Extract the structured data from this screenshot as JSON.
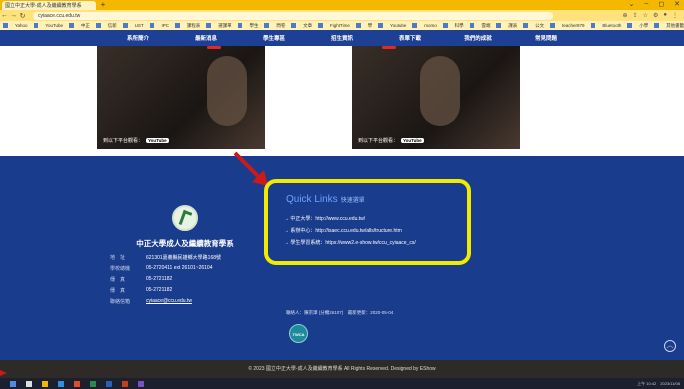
{
  "browser": {
    "tab_title": "國立中正大學-成人及繼續教育學系",
    "new_tab": "+",
    "url": "cyiaace.ccu.edu.tw",
    "window_controls": [
      "⌄",
      "–",
      "◻",
      "✕"
    ],
    "bookmarks": [
      "Yahoo",
      "YouTube",
      "中正",
      "信新",
      "UST",
      "IPC",
      "課程表",
      "選課單",
      "學生",
      "問卷",
      "文章",
      "FightTime",
      "學",
      "Youtube",
      "momo",
      "科學",
      "雲端",
      "課表",
      "公文",
      "teacher879",
      "Bluetooth",
      "小學",
      "其他書籤"
    ]
  },
  "nav": {
    "items": [
      "系所簡介",
      "最新消息",
      "學生專區",
      "招生資訊",
      "表單下載",
      "我們的成就",
      "常見問題"
    ]
  },
  "videos": [
    {
      "caption": "到以下平台觀看：",
      "badge": "YouTube"
    },
    {
      "caption": "到以下平台觀看：",
      "badge": "YouTube"
    }
  ],
  "footer": {
    "school_name": "中正大學成人及繼續教育學系",
    "info": [
      {
        "label": "地　址",
        "value": "621301嘉義縣民雄鄉大學路168號"
      },
      {
        "label": "學校總機",
        "value": "05-2720411 ext 26101~26104"
      },
      {
        "label": "傳　真",
        "value": "05-2721182"
      },
      {
        "label": "傳　真",
        "value": "05-2721182"
      },
      {
        "label": "聯絡信箱",
        "value": "cyiaace@ccu.edu.tw"
      }
    ],
    "quick_links": {
      "title": "Quick Links",
      "subtitle": "快速選單",
      "items": [
        "→ 中正大學：http://www.ccu.edu.tw/",
        "→ 系辦中心：http://isaec.ccu.edu.tw/alls/tructure.htm",
        "→ 學生學習系統：https://www2.e-show.tw/ccu_cyiaace_cs/"
      ]
    },
    "contact_line": "聯絡人：陳宗澤 (分機26107)　最新更新：2020-05-04",
    "cert_label": "TWCA",
    "to_top": "︿",
    "copyright": "© 2023 國立中正大學-成人及繼續教育學系 All Rights Reserved. Designed by EShow"
  },
  "taskbar": {
    "time": "上午 10:42",
    "date": "2023/11/08"
  },
  "colors": {
    "accent_yellow": "#f2ea00",
    "footer_blue": "#1a3c8c",
    "arrow_red": "#cc1a1a"
  }
}
